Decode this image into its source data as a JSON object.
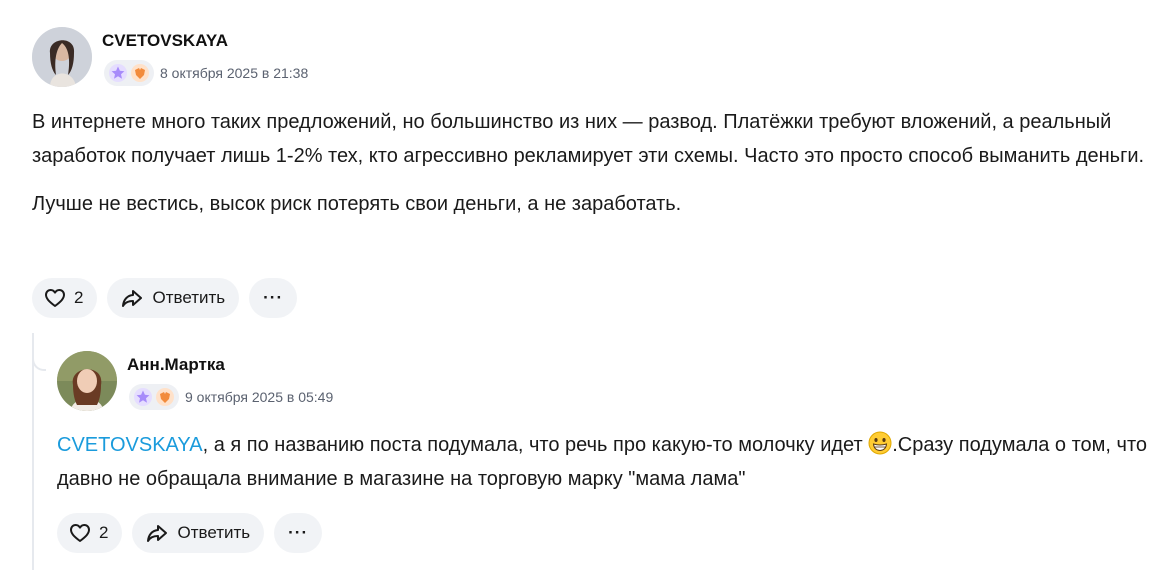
{
  "comments": [
    {
      "username": "CVETOVSKAYA",
      "timestamp": "8 октября 2025 в 21:38",
      "paragraphs": [
        "В интернете много таких предложений, но большинство из них — развод. Платёжки требуют вложений, а реальный заработок получает лишь 1-2% тех, кто агрессивно рекламирует эти схемы. Часто это просто способ выманить деньги.",
        "Лучше не вестись, высок риск потерять свои деньги, а не заработать."
      ],
      "likes": "2",
      "reply_label": "Ответить",
      "more_label": "···"
    },
    {
      "username": "Анн.Мартка",
      "timestamp": "9 октября 2025 в 05:49",
      "mention": "CVETOVSKAYA",
      "text_part1": ", а я по названию поста подумала, что речь про какую-то молочку идет ",
      "text_part2": ".Сразу подумала о том, что давно не обращала внимание в магазине на торговую марку \"мама лама\"",
      "likes": "2",
      "reply_label": "Ответить",
      "more_label": "···"
    }
  ],
  "colors": {
    "mention": "#1a9bdc",
    "pill_bg": "#f1f3f6",
    "badge_star": "#a78bfa",
    "badge_heart": "#f28b3c"
  },
  "icons": [
    "heart-icon",
    "share-arrow-icon",
    "more-icon",
    "star-badge-icon",
    "heart-badge-icon",
    "grinning-emoji-icon"
  ]
}
